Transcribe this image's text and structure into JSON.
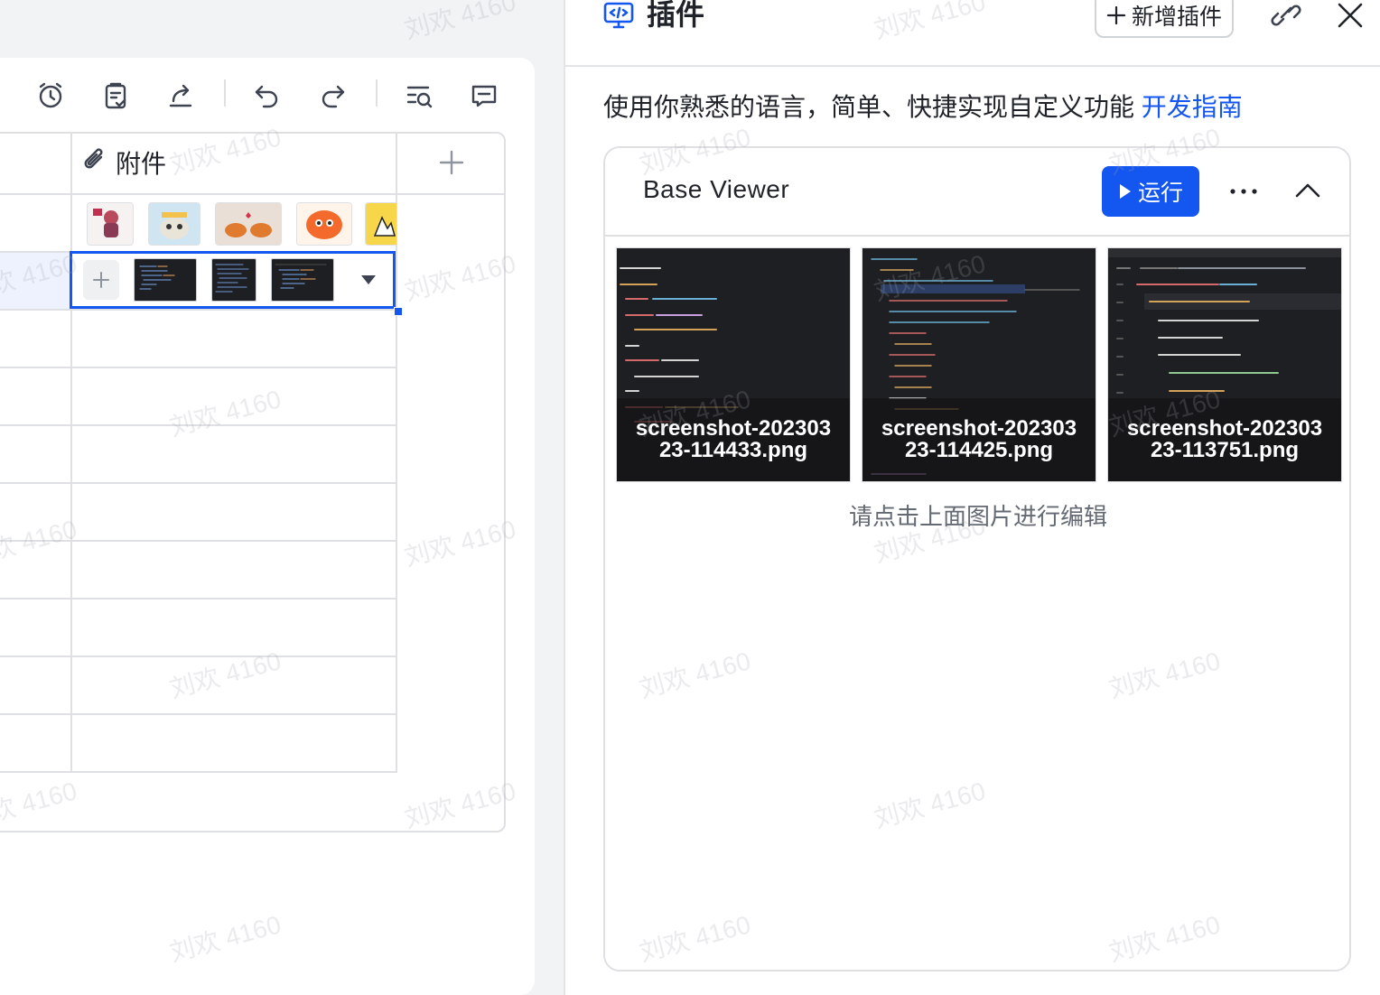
{
  "toolbar": {
    "icons": [
      "alarm-clock-icon",
      "clipboard-check-icon",
      "share-icon",
      "undo-icon",
      "redo-icon",
      "search-list-icon",
      "comment-icon"
    ]
  },
  "table": {
    "attachment_header": "附件",
    "attachment_thumbnails": [
      "sticker-girl",
      "sticker-robot",
      "sticker-crabs",
      "sticker-orange-blob",
      "sticker-yellow-sketch"
    ],
    "editing_cell_thumbnails": [
      "code-screenshot-1",
      "code-screenshot-2",
      "code-screenshot-3"
    ]
  },
  "panel": {
    "title": "插件",
    "add_plugin_label": "新增插件",
    "intro_text": "使用你熟悉的语言，简单、快捷实现自定义功能 ",
    "intro_link": "开发指南",
    "plugin": {
      "name": "Base Viewer",
      "run_label": "运行",
      "images": [
        {
          "filename": "screenshot-20230323-114433.png"
        },
        {
          "filename": "screenshot-20230323-114425.png"
        },
        {
          "filename": "screenshot-20230323-113751.png"
        }
      ],
      "hint": "请点击上面图片进行编辑"
    }
  },
  "watermark": "刘欢 4160",
  "colors": {
    "accent": "#1456f0",
    "border": "#dee0e3",
    "text": "#1f2329",
    "muted": "#646a73"
  }
}
